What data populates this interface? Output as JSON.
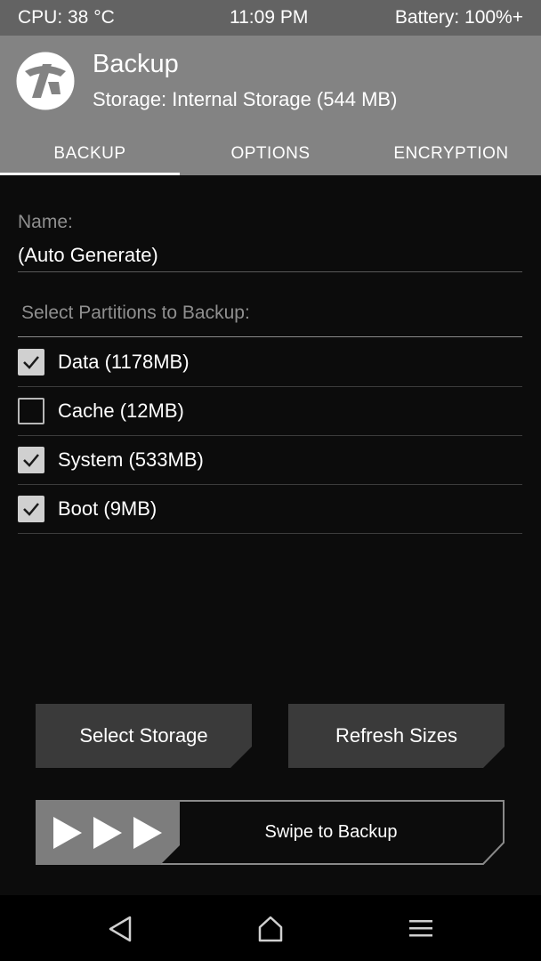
{
  "status_bar": {
    "cpu": "CPU: 38 °C",
    "time": "11:09 PM",
    "battery": "Battery: 100%+"
  },
  "header": {
    "title": "Backup",
    "storage": "Storage: Internal Storage (544 MB)",
    "logo_icon": "twrp-logo-icon"
  },
  "tabs": [
    {
      "label": "BACKUP",
      "active": true
    },
    {
      "label": "OPTIONS",
      "active": false
    },
    {
      "label": "ENCRYPTION",
      "active": false
    }
  ],
  "name_field": {
    "label": "Name:",
    "value": "(Auto Generate)"
  },
  "partitions": {
    "label": "Select Partitions to Backup:",
    "items": [
      {
        "label": "Data (1178MB)",
        "checked": true
      },
      {
        "label": "Cache (12MB)",
        "checked": false
      },
      {
        "label": "System (533MB)",
        "checked": true
      },
      {
        "label": "Boot (9MB)",
        "checked": true
      }
    ]
  },
  "buttons": {
    "select_storage": "Select Storage",
    "refresh_sizes": "Refresh Sizes"
  },
  "swipe": {
    "label": "Swipe to Backup",
    "icon": "triple-arrow-icon"
  },
  "navbar": {
    "back_icon": "back-triangle-icon",
    "home_icon": "home-icon",
    "menu_icon": "menu-icon"
  },
  "colors": {
    "status_bar": "#636363",
    "header": "#838383",
    "background": "#0c0c0c",
    "button": "#3a3a3a",
    "swipe_handle": "#7d7d7d"
  }
}
